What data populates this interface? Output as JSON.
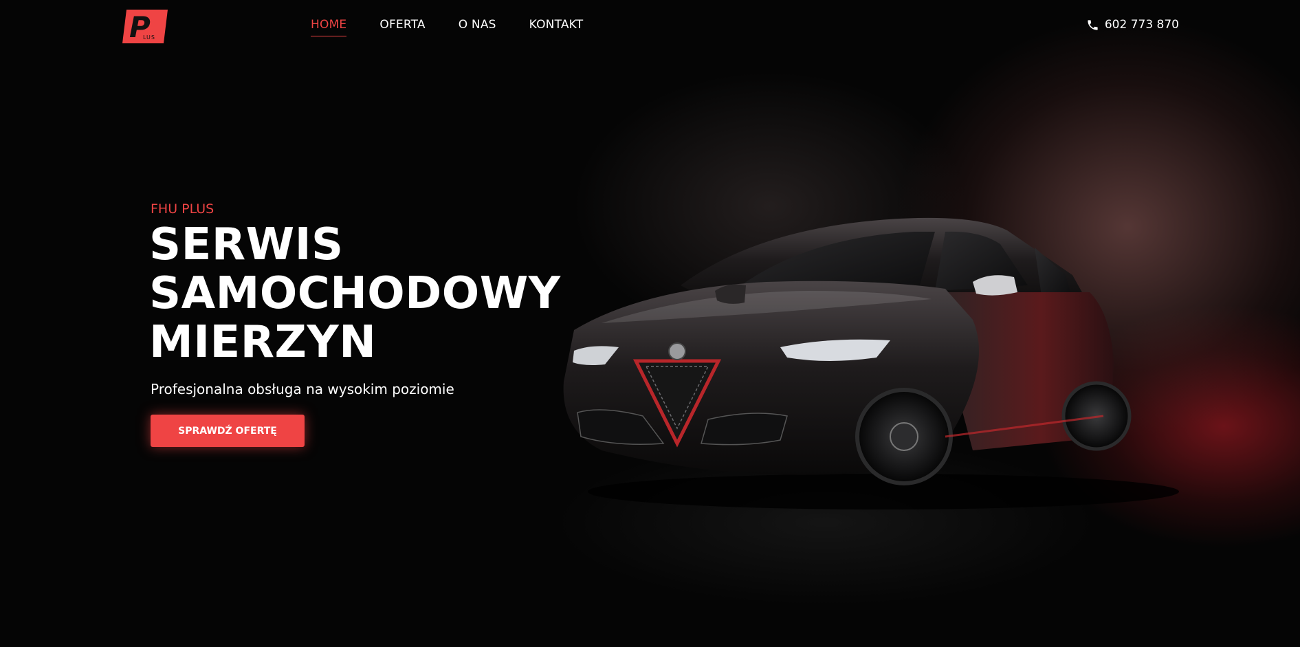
{
  "header": {
    "logo": {
      "letter": "P",
      "subtext": "LUS",
      "color": "#ef4444"
    },
    "nav": [
      {
        "label": "HOME",
        "active": true
      },
      {
        "label": "OFERTA",
        "active": false
      },
      {
        "label": "O NAS",
        "active": false
      },
      {
        "label": "KONTAKT",
        "active": false
      }
    ],
    "phone": {
      "icon": "phone-icon",
      "number": "602 773 870"
    }
  },
  "hero": {
    "eyebrow": "FHU PLUS",
    "headline": [
      "SERWIS",
      "SAMOCHODOWY",
      "MIERZYN"
    ],
    "subtitle": "Profesjonalna obsługa na wysokim poziomie",
    "cta_label": "SPRAWDŹ OFERTĘ"
  },
  "colors": {
    "accent": "#ef4444",
    "background": "#000000",
    "text": "#ffffff"
  }
}
